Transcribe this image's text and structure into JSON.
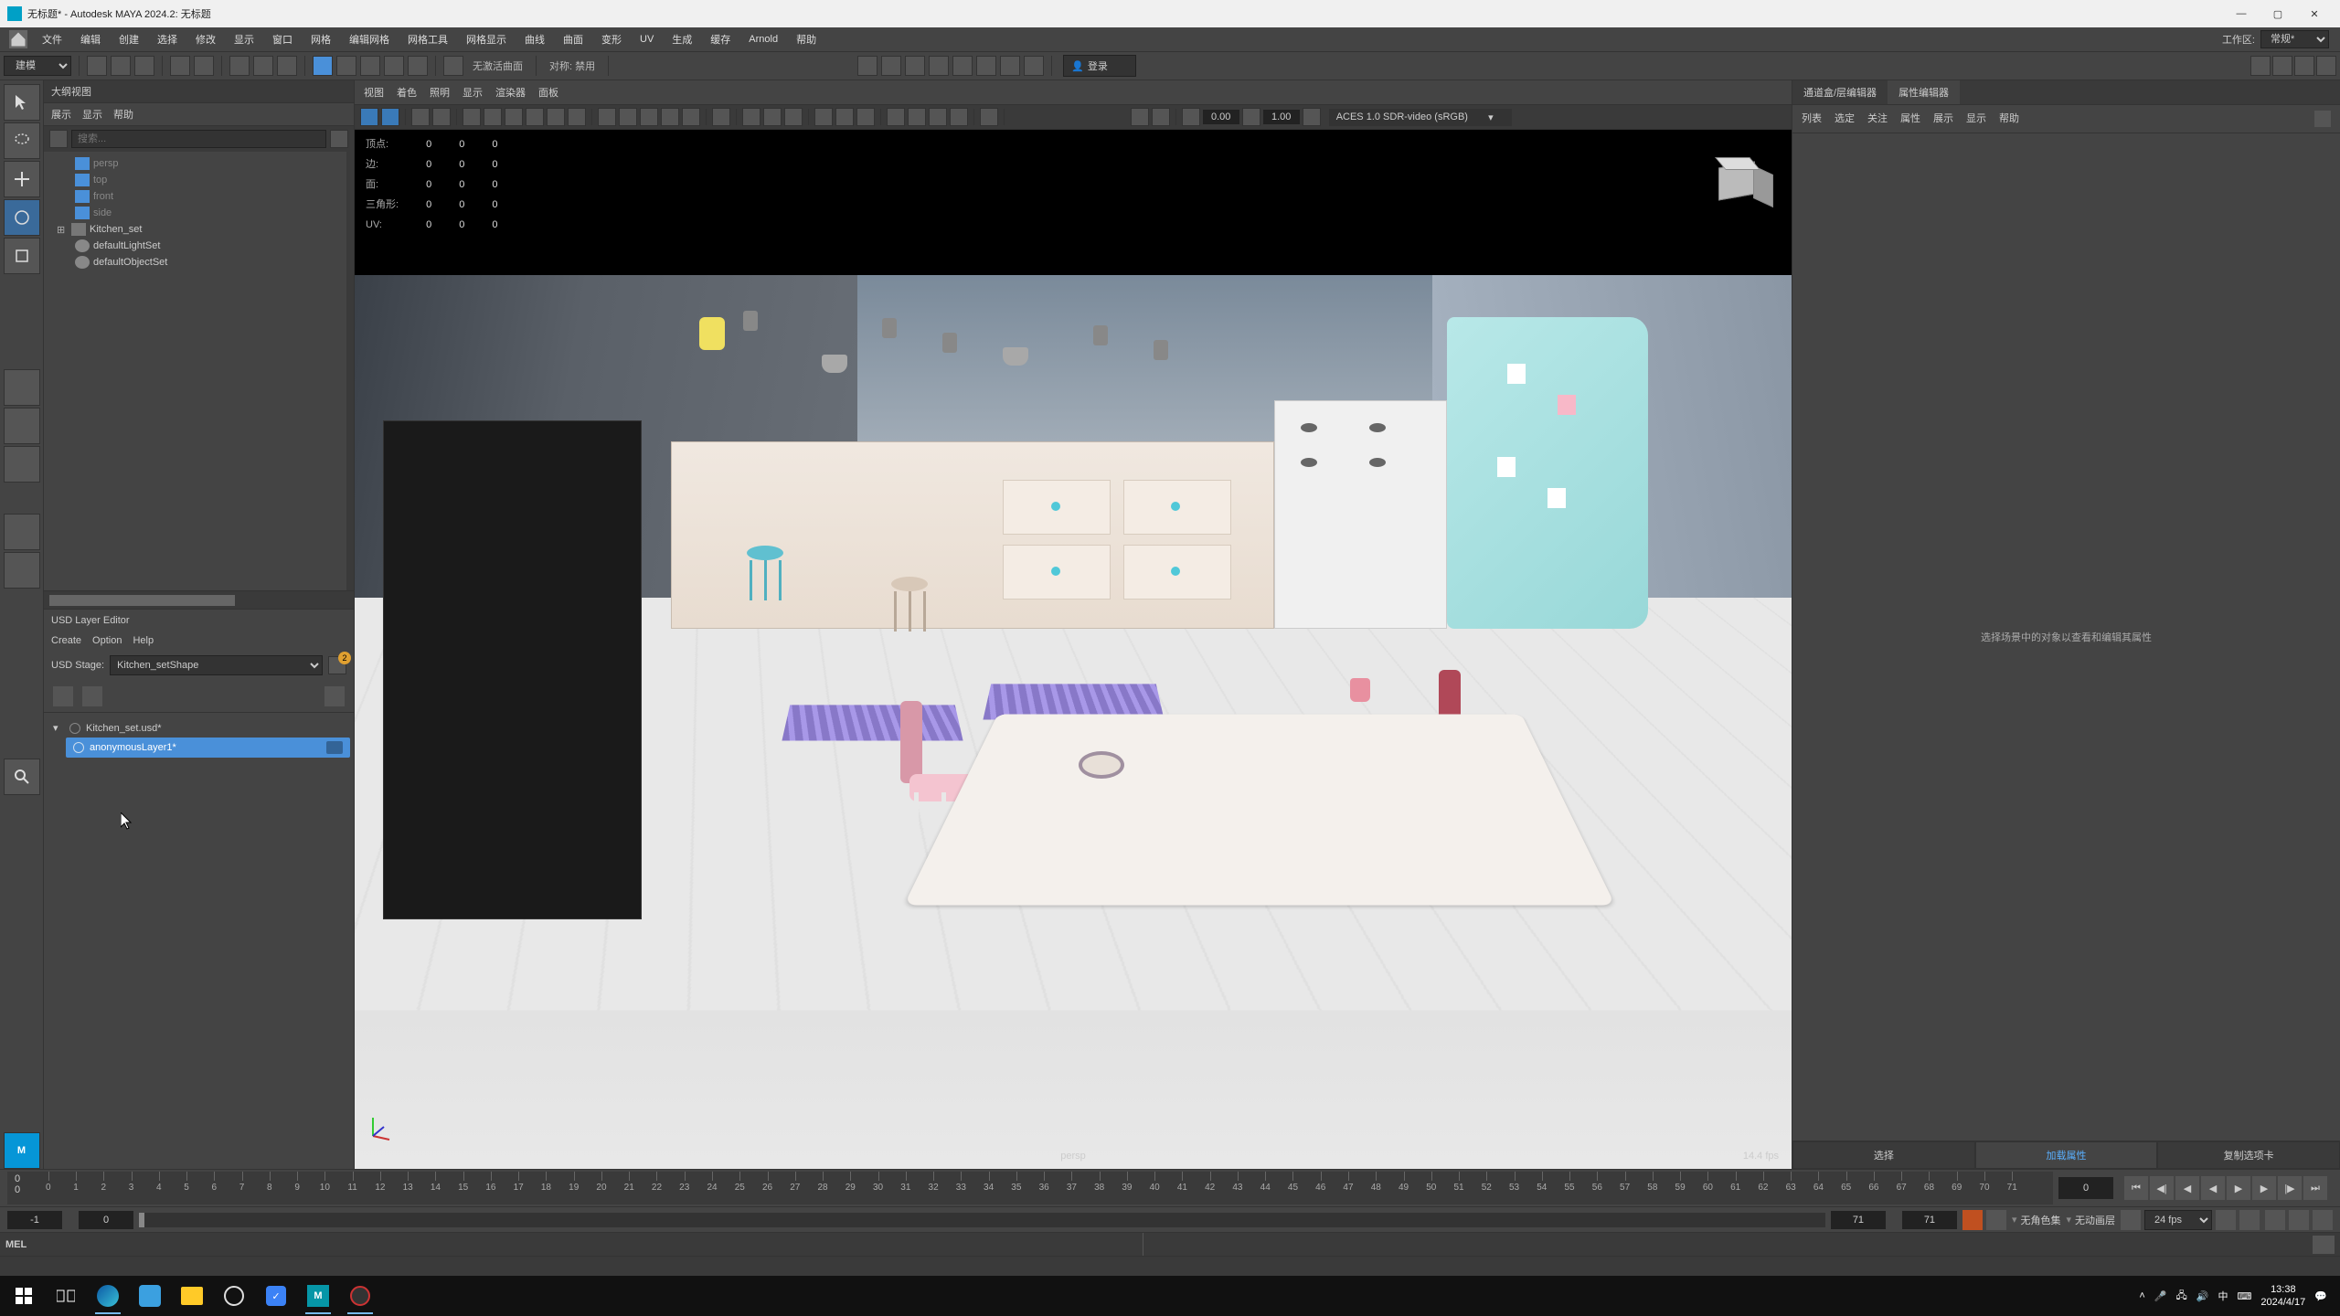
{
  "title": "无标题* - Autodesk MAYA 2024.2: 无标题",
  "menubar": [
    "文件",
    "编辑",
    "创建",
    "选择",
    "修改",
    "显示",
    "窗口",
    "网格",
    "编辑网格",
    "网格工具",
    "网格显示",
    "曲线",
    "曲面",
    "变形",
    "UV",
    "生成",
    "缓存",
    "Arnold",
    "帮助"
  ],
  "workspace_label": "工作区:",
  "workspace_value": "常规*",
  "shelf": {
    "dropdown": "建模",
    "snap_label": "无激活曲面",
    "sym_label": "对称: 禁用",
    "login": "登录"
  },
  "outliner": {
    "title": "大纲视图",
    "tabs": [
      "展示",
      "显示",
      "帮助"
    ],
    "search_ph": "搜索...",
    "items": [
      {
        "label": "persp",
        "type": "cam",
        "dim": true
      },
      {
        "label": "top",
        "type": "cam",
        "dim": true
      },
      {
        "label": "front",
        "type": "cam",
        "dim": true
      },
      {
        "label": "side",
        "type": "cam",
        "dim": true
      },
      {
        "label": "Kitchen_set",
        "type": "node",
        "exp": "+"
      },
      {
        "label": "defaultLightSet",
        "type": "set"
      },
      {
        "label": "defaultObjectSet",
        "type": "set"
      }
    ]
  },
  "usd": {
    "title": "USD Layer Editor",
    "menu": [
      "Create",
      "Option",
      "Help"
    ],
    "stage_label": "USD Stage:",
    "stage_value": "Kitchen_setShape",
    "badge": "2",
    "root": "Kitchen_set.usd*",
    "child": "anonymousLayer1*"
  },
  "viewport": {
    "menu": [
      "视图",
      "着色",
      "照明",
      "显示",
      "渲染器",
      "面板"
    ],
    "numA": "0.00",
    "numB": "1.00",
    "aces": "ACES 1.0 SDR-video (sRGB)",
    "stats": [
      [
        "顶点:",
        "0",
        "0",
        "0"
      ],
      [
        "边:",
        "0",
        "0",
        "0"
      ],
      [
        "面:",
        "0",
        "0",
        "0"
      ],
      [
        "三角形:",
        "0",
        "0",
        "0"
      ],
      [
        "UV:",
        "0",
        "0",
        "0"
      ]
    ],
    "camera": "persp",
    "fps": "14.4 fps"
  },
  "rightpanel": {
    "tabs": [
      "通道盒/层编辑器",
      "属性编辑器"
    ],
    "subtabs": [
      "列表",
      "选定",
      "关注",
      "属性",
      "展示",
      "显示",
      "帮助"
    ],
    "placeholder": "选择场景中的对象以查看和编辑其属性"
  },
  "bottombar": [
    "选择",
    "加载属性",
    "复制选项卡"
  ],
  "time": {
    "current": "0",
    "start": "-1",
    "rs": "0",
    "re": "71",
    "end": "71",
    "nochar": "无角色集",
    "nolayer": "无动画层",
    "fps": "24 fps"
  },
  "cmd": {
    "lang": "MEL"
  },
  "taskbar": {
    "time": "13:38",
    "date": "2024/4/17",
    "ime": "中"
  }
}
